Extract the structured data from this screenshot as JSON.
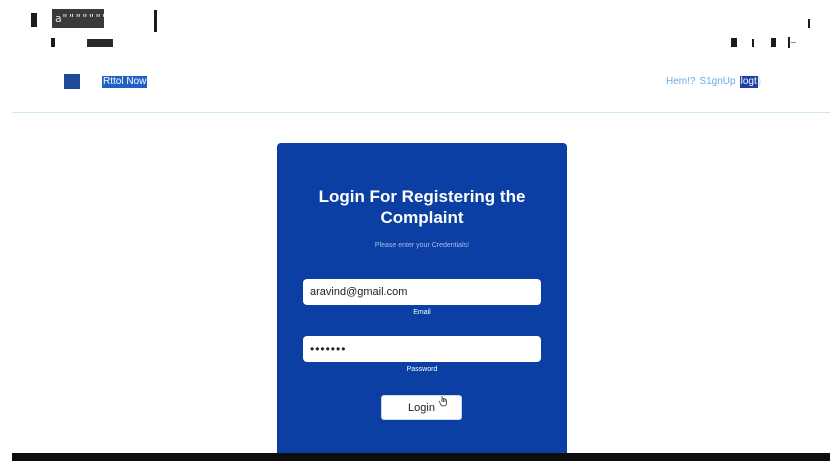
{
  "top": {
    "tab_text": "a\"\"\"\"\"\"\"\"\""
  },
  "navbar": {
    "brand": "Rttol   Now",
    "links": [
      {
        "label": "Hem!?"
      },
      {
        "label": "S1gnUp"
      },
      {
        "label": "logt"
      }
    ],
    "trailer": ")"
  },
  "login": {
    "title": "Login For Registering the Complaint",
    "subtitle": "Please enter your Credentials!",
    "email_value": "aravind@gmail.com",
    "email_label": "Email",
    "password_value": "•••••••",
    "password_label": "Password",
    "button_label": "Login"
  },
  "colors": {
    "card_bg": "#0b3fa4",
    "nav_link": "#6fa7e0",
    "active_link_bg": "#1e3fa8"
  }
}
